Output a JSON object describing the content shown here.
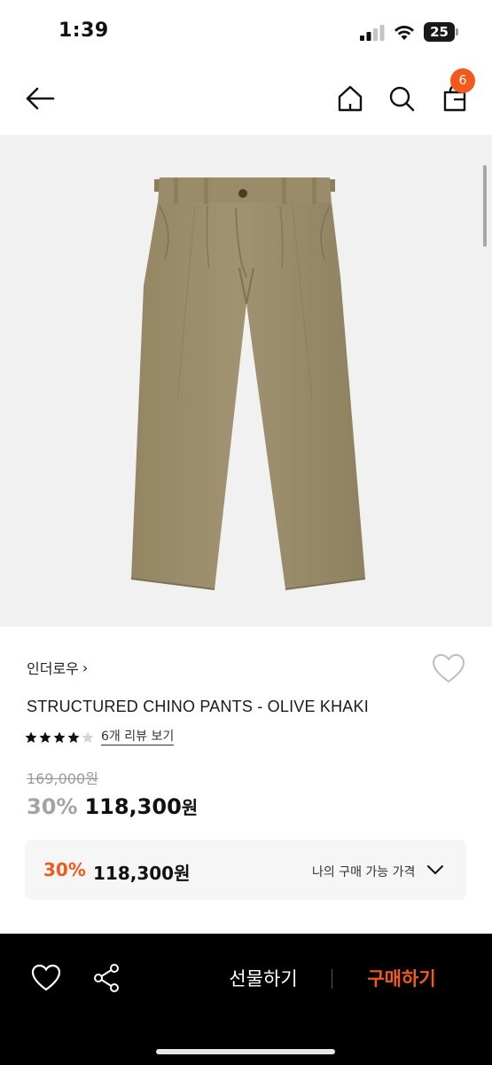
{
  "status": {
    "time": "1:39",
    "battery": "25"
  },
  "nav": {
    "back_icon": "arrow-left-icon",
    "home_icon": "home-icon",
    "search_icon": "search-icon",
    "cart_icon": "shopping-bag-icon",
    "cart_count": "6"
  },
  "product": {
    "image_icon": "olive-khaki-pants",
    "brand": "인더로우",
    "brand_chevron": "›",
    "title": "STRUCTURED CHINO PANTS - OLIVE KHAKI",
    "rating": 4,
    "rating_max": 5,
    "review_link": "6개 리뷰 보기",
    "original_price": "169,000원",
    "discount": "30%",
    "sale_price": "118,300",
    "sale_unit": "원"
  },
  "my_price": {
    "discount": "30%",
    "price": "118,300원",
    "label": "나의 구매 가능 가격"
  },
  "bottom_bar": {
    "gift_label": "선물하기",
    "buy_label": "구매하기"
  },
  "colors": {
    "accent": "#f25a1c",
    "background": "#ffffff",
    "bottom_bar": "#000000",
    "price_box": "#f6f6f6"
  }
}
